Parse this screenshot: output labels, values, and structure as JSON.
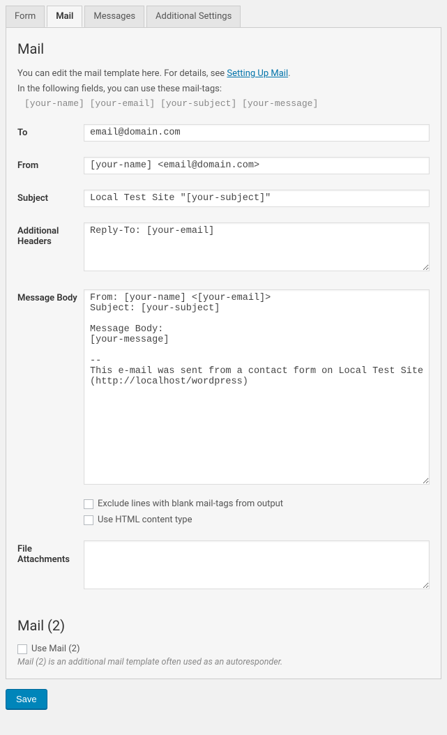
{
  "tabs": {
    "form": "Form",
    "mail": "Mail",
    "messages": "Messages",
    "additional": "Additional Settings"
  },
  "mail": {
    "title": "Mail",
    "intro1": "You can edit the mail template here. For details, see ",
    "intro_link": "Setting Up Mail",
    "intro1_end": ".",
    "intro2": "In the following fields, you can use these mail-tags:",
    "tags": "[your-name] [your-email] [your-subject] [your-message]",
    "labels": {
      "to": "To",
      "from": "From",
      "subject": "Subject",
      "additional_headers": "Additional Headers",
      "message_body": "Message Body",
      "file_attachments": "File Attachments"
    },
    "values": {
      "to": "email@domain.com",
      "from": "[your-name] <email@domain.com>",
      "subject": "Local Test Site \"[your-subject]\"",
      "additional_headers": "Reply-To: [your-email]",
      "message_body": "From: [your-name] <[your-email]>\nSubject: [your-subject]\n\nMessage Body:\n[your-message]\n\n--\nThis e-mail was sent from a contact form on Local Test Site (http://localhost/wordpress)",
      "file_attachments": ""
    },
    "checkboxes": {
      "exclude_blank": "Exclude lines with blank mail-tags from output",
      "use_html": "Use HTML content type"
    }
  },
  "mail2": {
    "title": "Mail (2)",
    "checkbox": "Use Mail (2)",
    "hint": "Mail (2) is an additional mail template often used as an autoresponder."
  },
  "buttons": {
    "save": "Save"
  }
}
